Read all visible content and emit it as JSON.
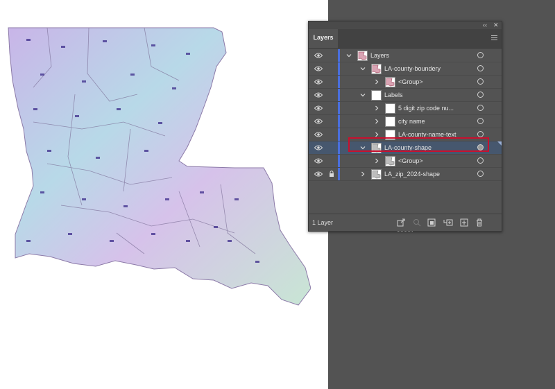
{
  "panel": {
    "tab": "Layers",
    "footer_count": "1 Layer"
  },
  "layers": [
    {
      "name": "Layers",
      "indent": 0,
      "expanded": true,
      "thumb": "map",
      "locked": false,
      "selected": false
    },
    {
      "name": "LA-county-boundery",
      "indent": 1,
      "expanded": true,
      "thumb": "map",
      "locked": false,
      "selected": false
    },
    {
      "name": "<Group>",
      "indent": 2,
      "expanded": false,
      "thumb": "map",
      "locked": false,
      "selected": false
    },
    {
      "name": "Labels",
      "indent": 1,
      "expanded": true,
      "thumb": "blank",
      "locked": false,
      "selected": false
    },
    {
      "name": "5 digit zip code nu...",
      "indent": 2,
      "expanded": false,
      "thumb": "blank",
      "locked": false,
      "selected": false
    },
    {
      "name": "city name",
      "indent": 2,
      "expanded": false,
      "thumb": "blank",
      "locked": false,
      "selected": false
    },
    {
      "name": "LA-county-name-text",
      "indent": 2,
      "expanded": false,
      "thumb": "blank",
      "locked": false,
      "selected": false
    },
    {
      "name": "LA-county-shape",
      "indent": 1,
      "expanded": true,
      "thumb": "gray",
      "locked": false,
      "selected": true
    },
    {
      "name": "<Group>",
      "indent": 2,
      "expanded": false,
      "thumb": "gray",
      "locked": false,
      "selected": false
    },
    {
      "name": "LA_zip_2024-shape",
      "indent": 1,
      "expanded": false,
      "thumb": "gray",
      "locked": true,
      "selected": false
    }
  ],
  "footer_icons": [
    "export-icon",
    "search-icon",
    "clip-mask-icon",
    "new-sublayer-icon",
    "new-layer-icon",
    "trash-icon"
  ],
  "colors": {
    "pasteboard": "#535353",
    "selection": "#46576e",
    "layer_bar": "#4a6fdc",
    "highlight": "#c8102e"
  }
}
